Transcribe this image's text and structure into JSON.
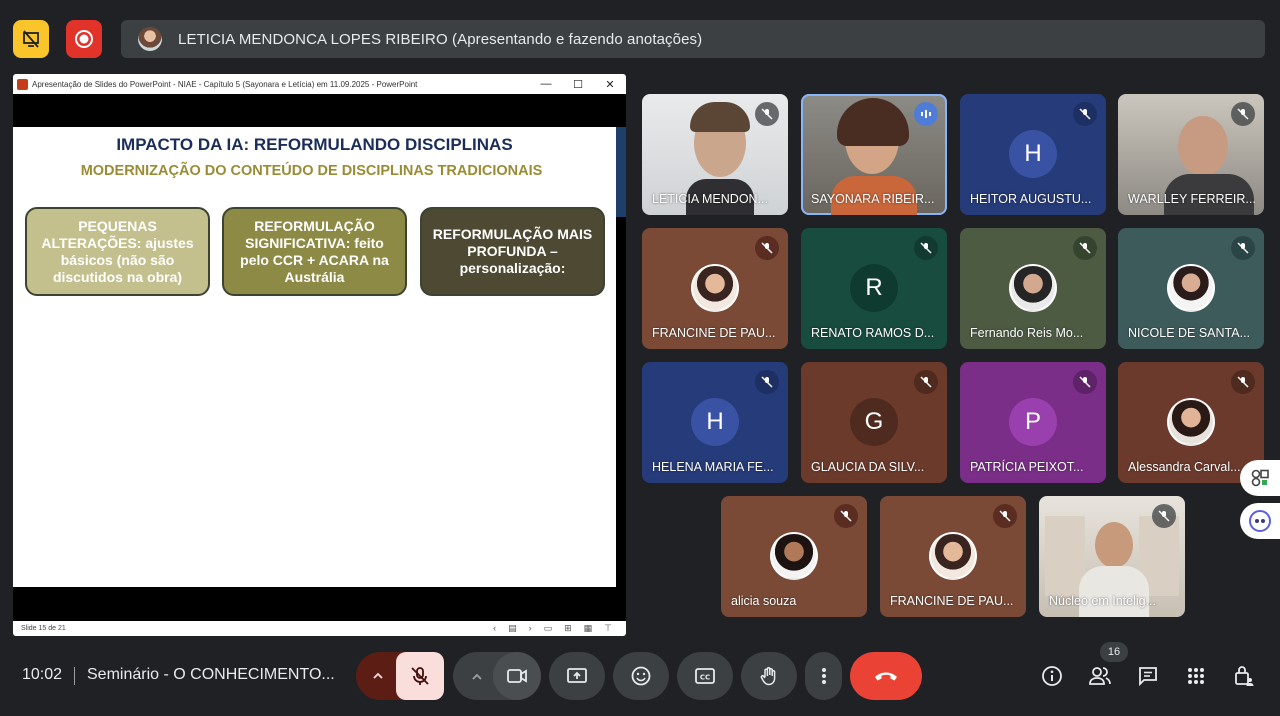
{
  "presenter": {
    "name": "LETICIA MENDONCA LOPES RIBEIRO (Apresentando e fazendo anotações)"
  },
  "ppt": {
    "window_title": "Apresentação de Slides do PowerPoint  -  NIAE - Capítulo 5 (Sayonara e Letícia) em 11.09.2025 - PowerPoint",
    "slide_title": "IMPACTO DA IA: REFORMULANDO DISCIPLINAS",
    "slide_subtitle": "MODERNIZAÇÃO DO CONTEÚDO DE DISCIPLINAS TRADICIONAIS",
    "boxes": [
      "PEQUENAS ALTERAÇÕES: ajustes básicos (não são discutidos na obra)",
      "REFORMULAÇÃO SIGNIFICATIVA: feito pelo CCR + ACARA na Austrália",
      "REFORMULAÇÃO MAIS PROFUNDA – personalização:"
    ],
    "status": "Slide 15 de 21"
  },
  "participants": [
    {
      "name": "LETICIA MENDON..."
    },
    {
      "name": "SAYONARA RIBEIR..."
    },
    {
      "name": "HEITOR AUGUSTU...",
      "initial": "H"
    },
    {
      "name": "WARLLEY FERREIR..."
    },
    {
      "name": "FRANCINE DE PAU..."
    },
    {
      "name": "RENATO RAMOS D...",
      "initial": "R"
    },
    {
      "name": "Fernando Reis Mo..."
    },
    {
      "name": "NICOLE DE SANTA..."
    },
    {
      "name": "HELENA MARIA FE...",
      "initial": "H"
    },
    {
      "name": "GLAUCIA DA SILV...",
      "initial": "G"
    },
    {
      "name": "PATRÍCIA PEIXOT...",
      "initial": "P"
    },
    {
      "name": "Alessandra Carval..."
    },
    {
      "name": "alicia souza"
    },
    {
      "name": "FRANCINE DE PAU..."
    },
    {
      "name": "Núcleo em Intelig..."
    }
  ],
  "bottom": {
    "time": "10:02",
    "meeting_title": "Seminário - O CONHECIMENTO...",
    "participant_count": "16"
  },
  "colors": {
    "background": "#202124",
    "end_call": "#ea4335",
    "mic_off": "#f9dedc",
    "accent": "#8ab4f8"
  }
}
